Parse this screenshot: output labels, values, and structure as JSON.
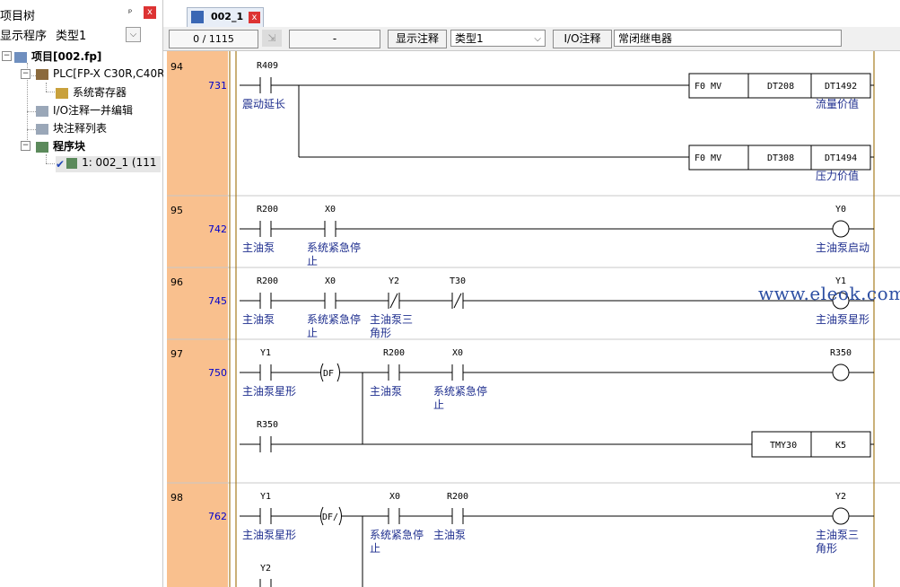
{
  "left_panel": {
    "title": "项目树",
    "pin": "ᵖ",
    "close": "x",
    "display_label": "显示程序",
    "type_label": "类型1",
    "combo_arrow": "⌵",
    "tree": [
      {
        "label": "项目[002.fp]",
        "bold": true
      },
      {
        "label": "PLC[FP-X C30R,C40R",
        "bold": false
      },
      {
        "label": "系统寄存器",
        "bold": false
      },
      {
        "label": "I/O注释一并编辑",
        "bold": false
      },
      {
        "label": "块注释列表",
        "bold": false
      },
      {
        "label": "程序块",
        "bold": true
      },
      {
        "label": "1: 002_1 (111",
        "bold": false
      }
    ]
  },
  "tab": {
    "label": "002_1",
    "close": "x"
  },
  "toolbar": {
    "position": "0 /  1115",
    "field": "-",
    "show_comment": "显示注释",
    "type_select": "类型1",
    "io_comment": "I/O注释",
    "io_value": "常闭继电器",
    "arrow": "⌵"
  },
  "rungs": [
    {
      "no": "94",
      "step": "731"
    },
    {
      "no": "95",
      "step": "742"
    },
    {
      "no": "96",
      "step": "745"
    },
    {
      "no": "97",
      "step": "750"
    },
    {
      "no": "98",
      "step": "762"
    }
  ],
  "devices": {
    "r409": "R409",
    "r200": "R200",
    "x0": "X0",
    "y2": "Y2",
    "t30": "T30",
    "y0": "Y0",
    "y1": "Y1",
    "r350": "R350",
    "f0mv": "F0 MV",
    "dt208": "DT208",
    "dt1492": "DT1492",
    "dt308": "DT308",
    "dt1494": "DT1494",
    "tmy30": "TMY30",
    "k5": "K5",
    "df": "DF",
    "dfn": "DF/"
  },
  "comments": {
    "shock_delay": "震动延长",
    "flow_value": "流量价值",
    "pressure_value": "压力价值",
    "main_pump": "主油泵",
    "estop_1": "系统紧急停",
    "estop_2": "止",
    "main_pump_start": "主油泵启动",
    "delta_1": "主油泵三",
    "delta_2": "角形",
    "star": "主油泵星形"
  },
  "watermark": "www.eleok.com",
  "colors": {
    "rung_number_bg": "#f9c08e",
    "comment_text": "#1f2f8f",
    "step_text": "#0000cc",
    "rail": "#a77b1f"
  }
}
